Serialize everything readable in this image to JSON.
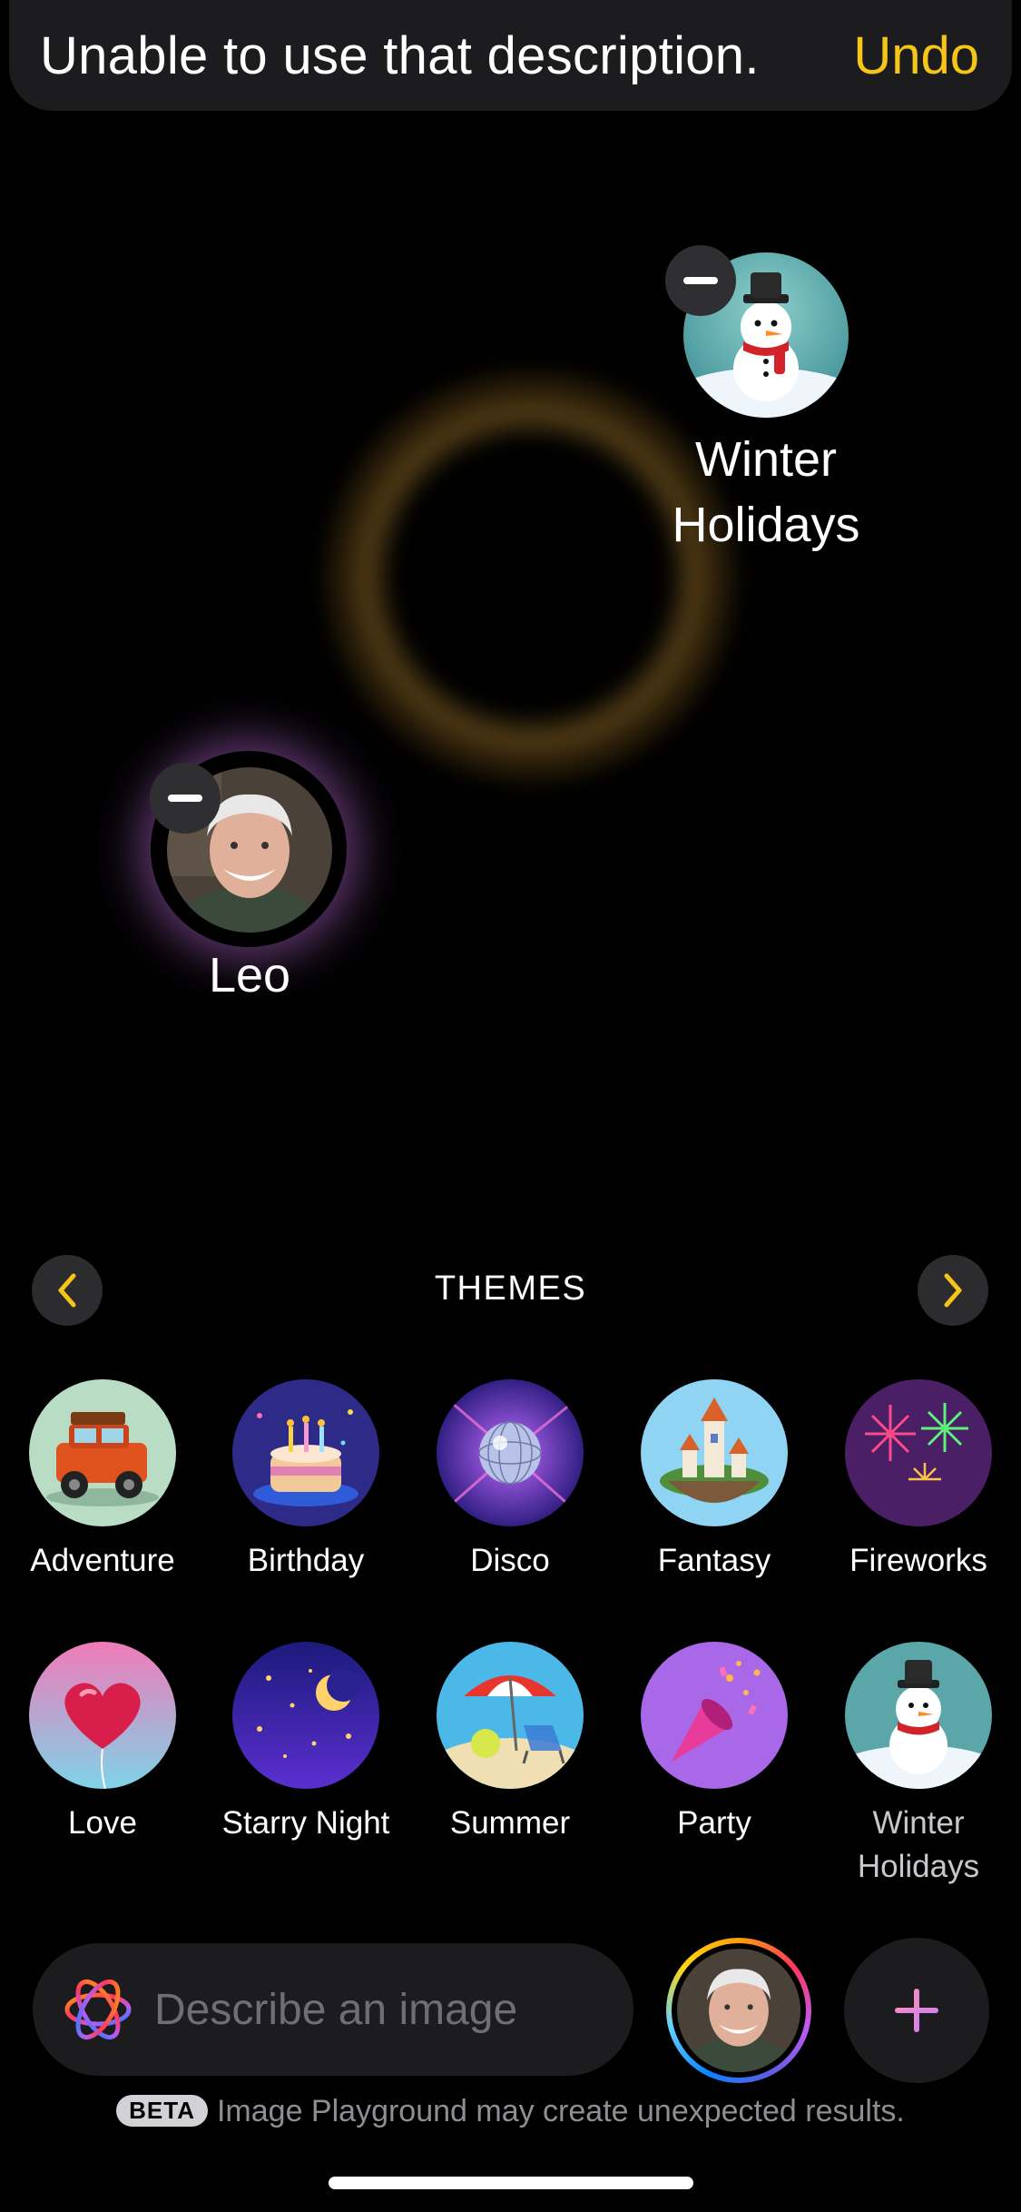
{
  "toast": {
    "message": "Unable to use that description.",
    "action": "Undo"
  },
  "canvas": {
    "concepts": [
      {
        "label_line1": "Winter",
        "label_line2": "Holidays",
        "icon": "snowman-icon"
      },
      {
        "label": "Leo",
        "icon": "person-photo"
      }
    ]
  },
  "themes": {
    "title": "THEMES",
    "items": [
      {
        "label": "Adventure",
        "icon": "jeep-icon"
      },
      {
        "label": "Birthday",
        "icon": "cake-icon"
      },
      {
        "label": "Disco",
        "icon": "disco-ball-icon"
      },
      {
        "label": "Fantasy",
        "icon": "castle-icon"
      },
      {
        "label": "Fireworks",
        "icon": "fireworks-icon"
      },
      {
        "label": "Love",
        "icon": "heart-balloon-icon"
      },
      {
        "label": "Starry Night",
        "icon": "moon-stars-icon"
      },
      {
        "label": "Summer",
        "icon": "beach-icon"
      },
      {
        "label": "Party",
        "icon": "party-popper-icon"
      },
      {
        "label": "Winter Holidays",
        "icon": "snowman-icon"
      }
    ]
  },
  "prompt": {
    "placeholder": "Describe an image"
  },
  "footer": {
    "badge": "BETA",
    "text": "Image Playground may create unexpected results."
  },
  "colors": {
    "accent": "#f5c518",
    "background": "#000000",
    "field": "#1c1c1e"
  }
}
